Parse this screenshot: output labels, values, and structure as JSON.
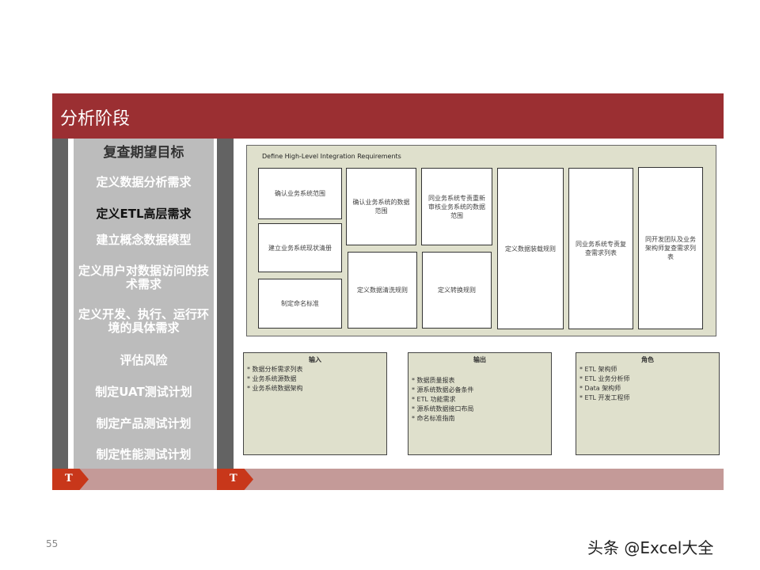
{
  "header": {
    "title": "分析阶段"
  },
  "left_panel": {
    "title": "复查期望目标",
    "items": [
      "定义数据分析需求",
      "定义ETL高层需求",
      "建立概念数据模型",
      "定义用户对数据访问的技术需求",
      "定义开发、执行、运行环境的具体需求",
      "评估风险",
      "制定UAT测试计划",
      "制定产品测试计划",
      "制定性能测试计划"
    ]
  },
  "tabs": {
    "left": "T",
    "right": "T"
  },
  "diagram": {
    "title": "Define High-Level Integration Requirements",
    "boxes": [
      "确认业务系统范围",
      "建立业务系统现状清册",
      "制定命名标准",
      "确认业务系统的数据范围",
      "定义数据清洗规则",
      "同业务系统专责重新审核业务系统的数据范围",
      "定义转换规则",
      "定义数据装载规则",
      "同业务系统专责复查需求列表",
      "同开发团队及业务架构师复查需求列表"
    ]
  },
  "panels": [
    {
      "title": "输入",
      "items": [
        "* 数据分析需求列表",
        "* 业务系统源数据",
        "* 业务系统数据架构"
      ]
    },
    {
      "title": "输出",
      "items": [
        "* 数据质量报表",
        "* 源系统数据必备条件",
        "* ETL 功能需求",
        "* 源系统数据接口布局",
        "* 命名标准指南"
      ]
    },
    {
      "title": "角色",
      "items": [
        "* ETL 架构师",
        "* ETL 业务分析师",
        "* Data 架构师",
        "* ETL 开发工程师"
      ]
    }
  ],
  "footer": {
    "page": "55",
    "watermark": "头条 @Excel大全"
  }
}
